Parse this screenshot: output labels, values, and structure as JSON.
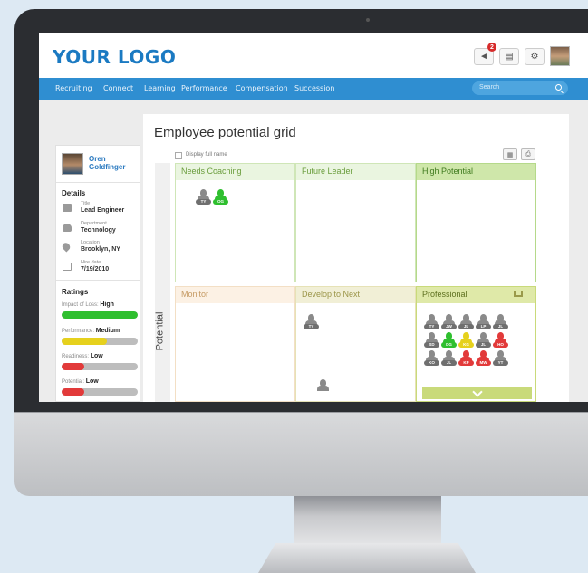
{
  "header": {
    "logo": "YOUR LOGO",
    "notification_count": "2"
  },
  "nav": {
    "items": [
      "Recruiting",
      "Connect",
      "Learning",
      "Performance",
      "Compensation",
      "Succession"
    ],
    "search_placeholder": "Search"
  },
  "page": {
    "title": "Employee potential grid",
    "display_full_name": "Display full name",
    "axis_label": "Potential"
  },
  "profile": {
    "first_name": "Oren",
    "last_name": "Goldfinger",
    "details_title": "Details",
    "title_label": "Title",
    "title_value": "Lead Engineer",
    "department_label": "Department",
    "department_value": "Technology",
    "location_label": "Location",
    "location_value": "Brooklyn, NY",
    "hire_label": "Hire date",
    "hire_value": "7/19/2010",
    "ratings_title": "Ratings",
    "ratings": [
      {
        "label": "Impact of Loss:",
        "value": "High",
        "level": 1.0,
        "color": "#2fbf2f"
      },
      {
        "label": "Performance:",
        "value": "Medium",
        "level": 0.6,
        "color": "#e6d11d"
      },
      {
        "label": "Readiness:",
        "value": "Low",
        "level": 0.3,
        "color": "#e23a3a"
      },
      {
        "label": "Potential:",
        "value": "Low",
        "level": 0.3,
        "color": "#e23a3a"
      }
    ]
  },
  "grid": {
    "cells": [
      {
        "title": "Needs Coaching",
        "people": [
          "TY",
          "OG"
        ]
      },
      {
        "title": "Future Leader",
        "people": []
      },
      {
        "title": "High Potential",
        "people": []
      },
      {
        "title": "Monitor",
        "people": []
      },
      {
        "title": "Develop to Next",
        "people": [
          "TY",
          ""
        ]
      },
      {
        "title": "Professional",
        "people": [
          "TY",
          "JW",
          "JL",
          "LP",
          "JL",
          "SD",
          "DG",
          "KG",
          "JL",
          "HO",
          "KO",
          "JL",
          "KP",
          "MW",
          "YT"
        ]
      }
    ]
  },
  "colors": {
    "brand": "#1b7ac2",
    "nav": "#2f8ed1",
    "green": "#2fbf2f",
    "yellow": "#e6d11d",
    "red": "#e23a3a",
    "gray_person": "#8a8a8a"
  }
}
